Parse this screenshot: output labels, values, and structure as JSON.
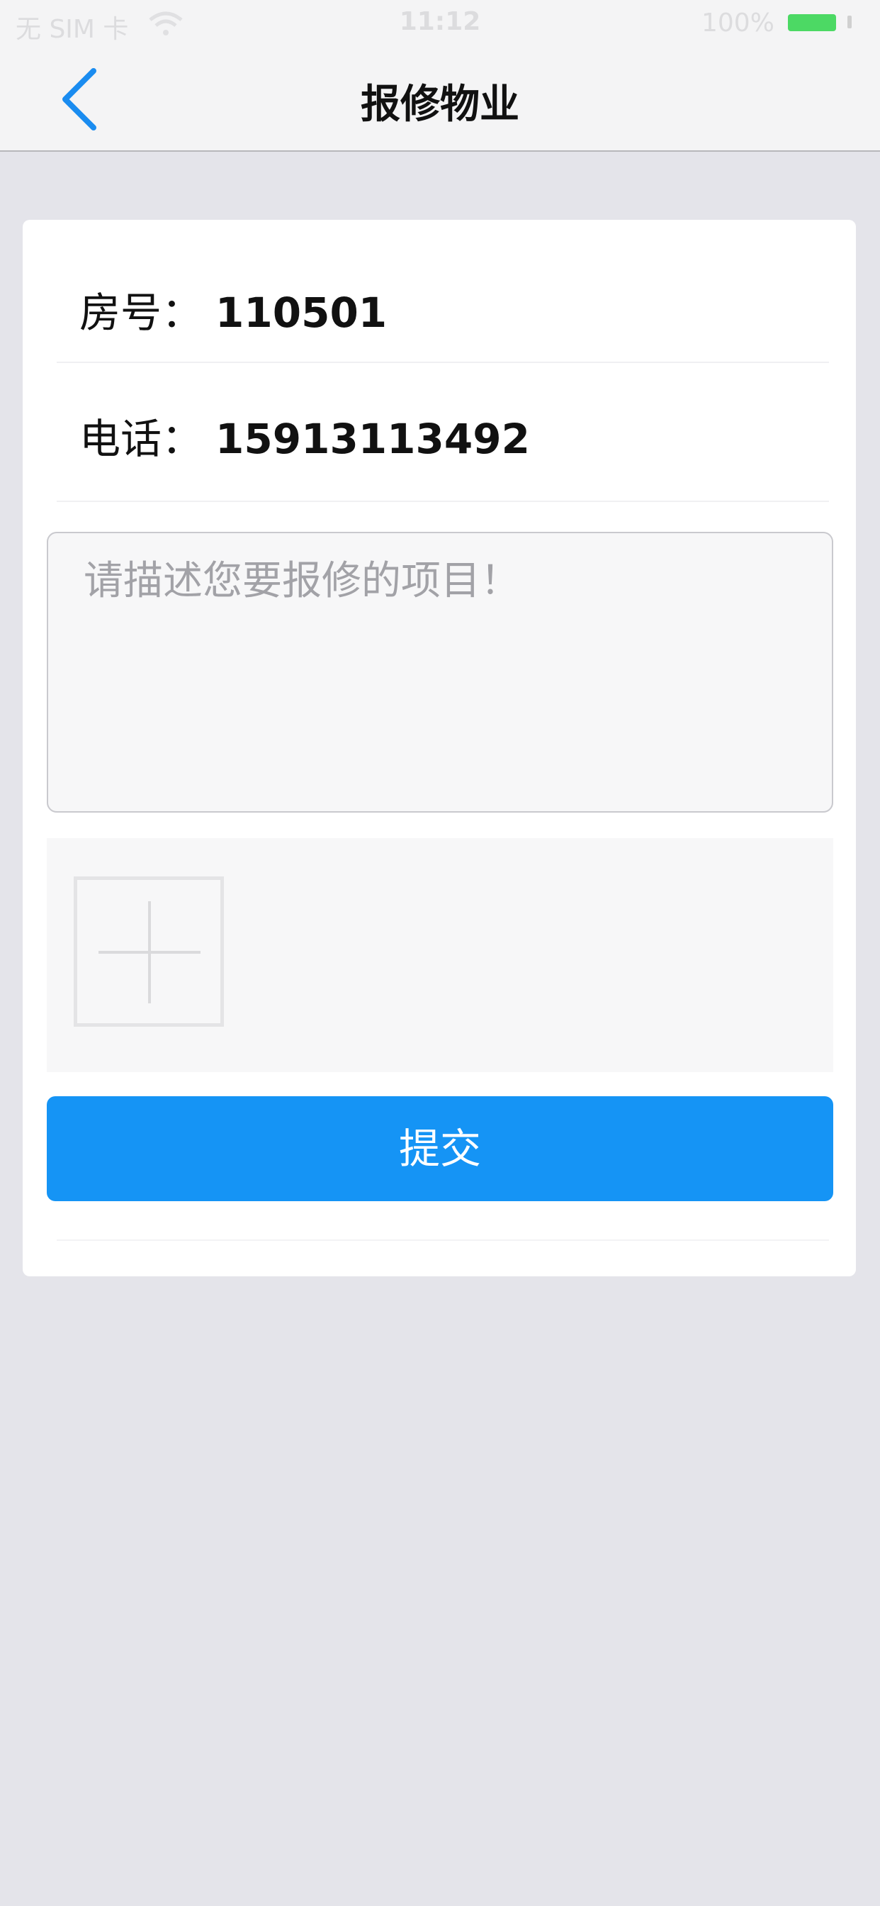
{
  "status_bar": {
    "carrier": "无 SIM 卡",
    "wifi_icon": "wifi-icon",
    "time": "11:12",
    "battery_percent_text": "100%",
    "battery_level": 1.0,
    "battery_color": "#4cd964"
  },
  "nav": {
    "back_icon": "chevron-left-icon",
    "title": "报修物业",
    "accent_color": "#1a8cf0"
  },
  "form": {
    "room_label": "房号：",
    "room_value": "110501",
    "phone_label": "电话：",
    "phone_value": "15913113492",
    "description_placeholder": "请描述您要报修的项目！",
    "description_value": "",
    "add_photo_icon": "plus-icon",
    "submit_label": "提交",
    "submit_color": "#1594f5"
  }
}
